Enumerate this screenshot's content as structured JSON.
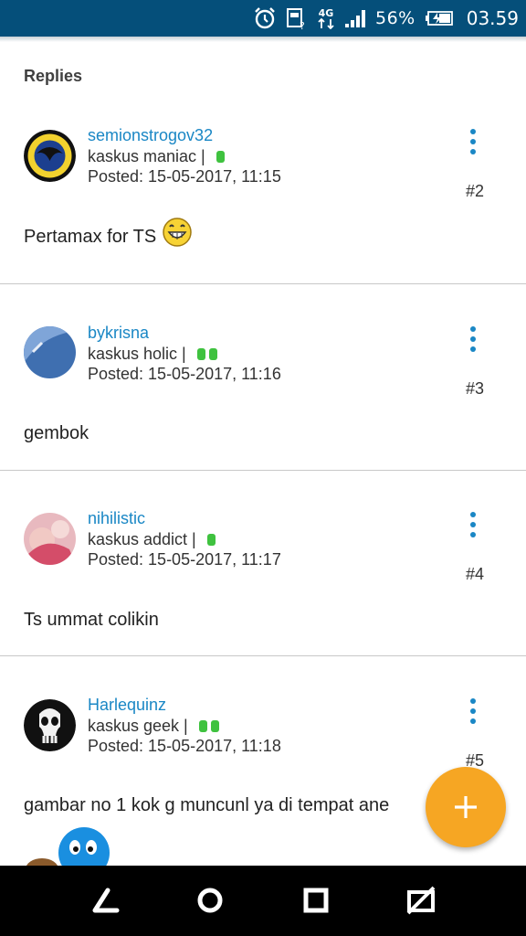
{
  "status_bar": {
    "network": "4G",
    "battery": "56%",
    "time": "03.59",
    "icons": [
      "alarm-icon",
      "data-saver-icon",
      "network-4g-icon",
      "signal-icon",
      "battery-charging-icon"
    ]
  },
  "section_title": "Replies",
  "posts": [
    {
      "username": "semionstrogov32",
      "rank": "kaskus maniac |",
      "posted": "Posted: 15-05-2017, 11:15",
      "number": "#2",
      "content": "Pertamax for TS",
      "reputation_dots": 1,
      "avatar": "emblem-avatar"
    },
    {
      "username": "bykrisna",
      "rank": "kaskus holic |",
      "posted": "Posted: 15-05-2017, 11:16",
      "number": "#3",
      "content": "gembok",
      "reputation_dots": 2,
      "avatar": "blue-photo-avatar"
    },
    {
      "username": "nihilistic",
      "rank": "kaskus addict |",
      "posted": "Posted: 15-05-2017, 11:17",
      "number": "#4",
      "content": "Ts ummat colikin",
      "reputation_dots": 1,
      "avatar": "pink-photo-avatar"
    },
    {
      "username": "Harlequinz",
      "rank": "kaskus geek |",
      "posted": "Posted: 15-05-2017, 11:18",
      "number": "#5",
      "content": "gambar no 1 kok g muncunl ya di tempat ane",
      "reputation_dots": 2,
      "avatar": "skull-avatar"
    }
  ],
  "fab": {
    "icon": "plus-icon"
  },
  "nav_bar": {
    "icons": [
      "back-icon",
      "home-icon",
      "recents-icon",
      "hide-keyboard-icon"
    ]
  },
  "colors": {
    "status_bar": "#054f7a",
    "link": "#1a87c5",
    "fab": "#f6a623",
    "reputation": "#3fc23f"
  }
}
